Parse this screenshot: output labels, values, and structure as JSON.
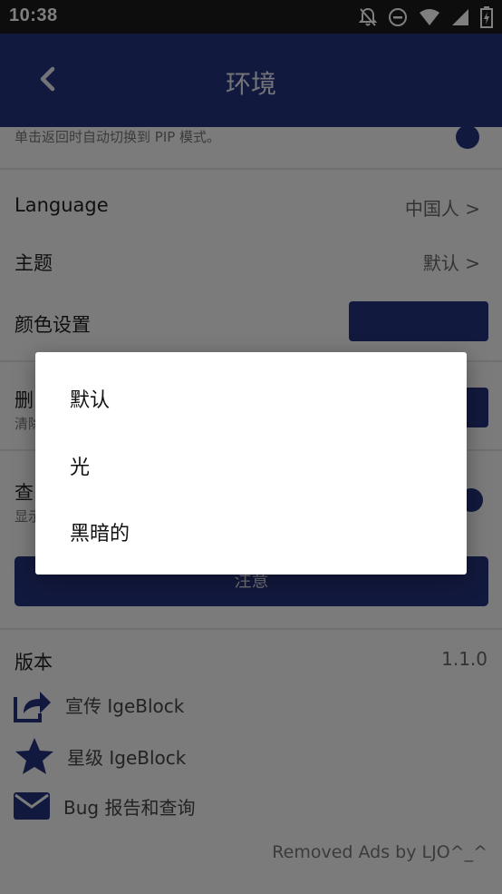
{
  "status": {
    "time": "10:38"
  },
  "appbar": {
    "title": "环境"
  },
  "pip": {
    "subtitle": "单击返回时自动切换到 PIP 模式。"
  },
  "language": {
    "label": "Language",
    "value": "中国人 >"
  },
  "theme": {
    "label": "主题",
    "value": "默认 >"
  },
  "color": {
    "label": "颜色设置"
  },
  "delete": {
    "label": "删",
    "subtitle": "清除"
  },
  "check": {
    "label": "查",
    "subtitle": "显示"
  },
  "notice_button": {
    "label": "注意"
  },
  "version": {
    "label": "版本",
    "value": "1.1.0"
  },
  "links": [
    {
      "label": "宣传 IgeBlock",
      "icon": "share-icon"
    },
    {
      "label": "星级 IgeBlock",
      "icon": "star-icon"
    },
    {
      "label": "Bug 报告和查询",
      "icon": "mail-icon"
    }
  ],
  "footer": {
    "note": "Removed Ads by LJO^_^"
  },
  "dialog": {
    "options": [
      "默认",
      "光",
      "黑暗的"
    ]
  },
  "colors": {
    "primary": "#24327d",
    "statusbar": "#1a1a1a"
  }
}
